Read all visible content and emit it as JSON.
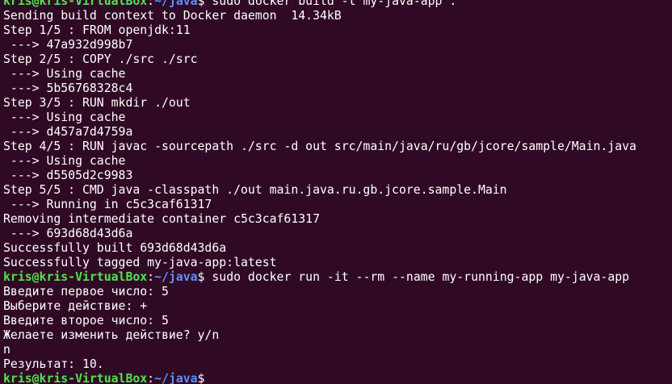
{
  "terminal": {
    "prompt_user": "kris@kris-VirtualBox",
    "prompt_sep": ":",
    "prompt_path": "~/java",
    "prompt_char": "$",
    "lines": [
      {
        "type": "prompt",
        "command": " sudo docker build -t my-java-app ."
      },
      {
        "type": "output",
        "text": "Sending build context to Docker daemon  14.34kB"
      },
      {
        "type": "output",
        "text": "Step 1/5 : FROM openjdk:11"
      },
      {
        "type": "output",
        "text": " ---> 47a932d998b7"
      },
      {
        "type": "output",
        "text": "Step 2/5 : COPY ./src ./src"
      },
      {
        "type": "output",
        "text": " ---> Using cache"
      },
      {
        "type": "output",
        "text": " ---> 5b56768328c4"
      },
      {
        "type": "output",
        "text": "Step 3/5 : RUN mkdir ./out"
      },
      {
        "type": "output",
        "text": " ---> Using cache"
      },
      {
        "type": "output",
        "text": " ---> d457a7d4759a"
      },
      {
        "type": "output",
        "text": "Step 4/5 : RUN javac -sourcepath ./src -d out src/main/java/ru/gb/jcore/sample/Main.java"
      },
      {
        "type": "output",
        "text": " ---> Using cache"
      },
      {
        "type": "output",
        "text": " ---> d5505d2c9983"
      },
      {
        "type": "output",
        "text": "Step 5/5 : CMD java -classpath ./out main.java.ru.gb.jcore.sample.Main"
      },
      {
        "type": "output",
        "text": " ---> Running in c5c3caf61317"
      },
      {
        "type": "output",
        "text": "Removing intermediate container c5c3caf61317"
      },
      {
        "type": "output",
        "text": " ---> 693d68d43d6a"
      },
      {
        "type": "output",
        "text": "Successfully built 693d68d43d6a"
      },
      {
        "type": "output",
        "text": "Successfully tagged my-java-app:latest"
      },
      {
        "type": "prompt",
        "command": " sudo docker run -it --rm --name my-running-app my-java-app"
      },
      {
        "type": "output",
        "text": "Введите первое число: 5"
      },
      {
        "type": "output",
        "text": "Выберите действие: +"
      },
      {
        "type": "output",
        "text": "Введите второе число: 5"
      },
      {
        "type": "output",
        "text": "Желаете изменить действие? y/n"
      },
      {
        "type": "output",
        "text": "n"
      },
      {
        "type": "output",
        "text": "Результат: 10."
      },
      {
        "type": "prompt",
        "command": ""
      }
    ]
  },
  "colors": {
    "background": "#300a24",
    "prompt_user": "#4ee44e",
    "prompt_path": "#5f8fff",
    "text": "#ffffff"
  }
}
